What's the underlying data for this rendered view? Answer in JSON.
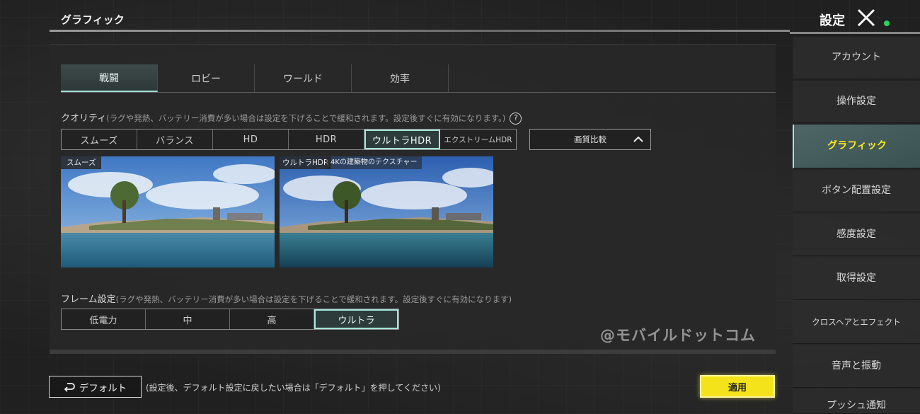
{
  "header": {
    "page_title": "グラフィック",
    "settings_label": "設定"
  },
  "tabs": [
    {
      "label": "戦闘",
      "active": true
    },
    {
      "label": "ロビー",
      "active": false
    },
    {
      "label": "ワールド",
      "active": false
    },
    {
      "label": "効率",
      "active": false
    }
  ],
  "quality": {
    "label": "クオリティ",
    "hint": "(ラグや発熱、バッテリー消費が多い場合は設定を下げることで緩和されます。設定後すぐに有効になります。)",
    "options": [
      "スムーズ",
      "バランス",
      "HD",
      "HDR",
      "ウルトラHDR",
      "エクストリームHDR"
    ],
    "selected": "ウルトラHDR",
    "compare_label": "画質比較"
  },
  "previews": {
    "left_tag": "スムーズ",
    "right_tag": "ウルトラHDR",
    "right_note": "4Kの建築物のテクスチャー"
  },
  "frame": {
    "label": "フレーム設定",
    "hint": "(ラグや発熱、バッテリー消費が多い場合は設定を下げることで緩和されます。設定後すぐに有効になります)",
    "options": [
      "低電力",
      "中",
      "高",
      "ウルトラ"
    ],
    "selected": "ウルトラ"
  },
  "watermark": "@モバイルドットコム",
  "footer": {
    "default_label": "デフォルト",
    "default_hint": "(設定後、デフォルト設定に戻したい場合は「デフォルト」を押してください)",
    "apply_label": "適用"
  },
  "sidebar": {
    "items": [
      {
        "label": "アカウント",
        "active": false
      },
      {
        "label": "操作設定",
        "active": false
      },
      {
        "label": "グラフィック",
        "active": true
      },
      {
        "label": "ボタン配置設定",
        "active": false
      },
      {
        "label": "感度設定",
        "active": false
      },
      {
        "label": "取得設定",
        "active": false
      },
      {
        "label": "クロスヘアとエフェクト",
        "active": false
      },
      {
        "label": "音声と振動",
        "active": false
      },
      {
        "label": "プッシュ通知",
        "active": false
      }
    ]
  },
  "colors": {
    "accent": "#a6e6da",
    "apply": "#f4e21a",
    "sidebar_active_text": "#ffe818",
    "online": "#2ed35a"
  }
}
